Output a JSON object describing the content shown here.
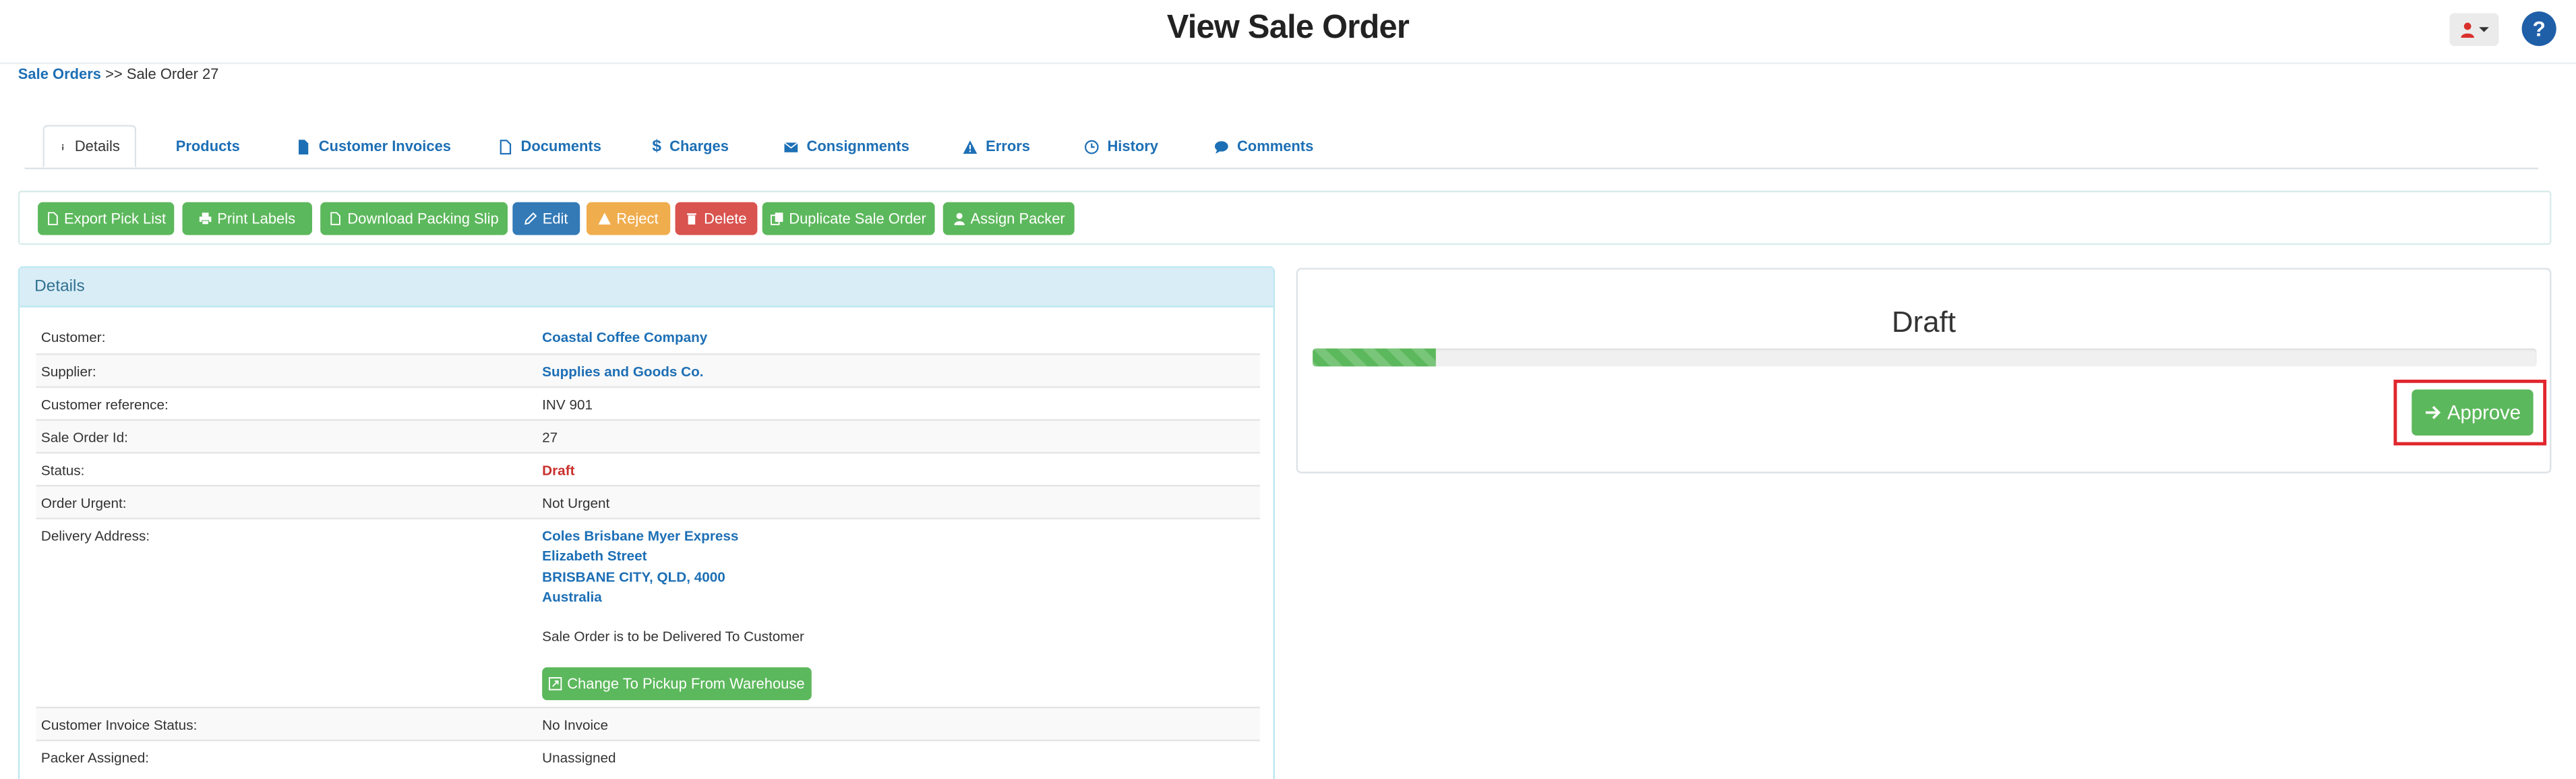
{
  "header": {
    "title": "View Sale Order",
    "help_label": "?"
  },
  "breadcrumb": {
    "link": "Sale Orders",
    "separator": ">>",
    "current": "Sale Order 27"
  },
  "tabs": [
    {
      "label": "Details",
      "icon": "info-icon"
    },
    {
      "label": "Products",
      "icon": ""
    },
    {
      "label": "Customer Invoices",
      "icon": "file-icon"
    },
    {
      "label": "Documents",
      "icon": "file-outline-icon"
    },
    {
      "label": "Charges",
      "icon": "dollar-icon"
    },
    {
      "label": "Consignments",
      "icon": "envelope-icon"
    },
    {
      "label": "Errors",
      "icon": "warning-icon"
    },
    {
      "label": "History",
      "icon": "clock-icon"
    },
    {
      "label": "Comments",
      "icon": "comment-icon"
    }
  ],
  "toolbar": {
    "export_pick_list": "Export Pick List",
    "print_labels": "Print Labels",
    "download_packing_slip": "Download Packing Slip",
    "edit": "Edit",
    "reject": "Reject",
    "delete": "Delete",
    "duplicate_sale_order": "Duplicate Sale Order",
    "assign_packer": "Assign Packer"
  },
  "details": {
    "heading": "Details",
    "rows": [
      {
        "label": "Customer:",
        "value": "Coastal Coffee Company"
      },
      {
        "label": "Supplier:",
        "value": "Supplies and Goods Co."
      },
      {
        "label": "Customer reference:",
        "value": "INV 901"
      },
      {
        "label": "Sale Order Id:",
        "value": "27"
      },
      {
        "label": "Status:",
        "value": "Draft"
      },
      {
        "label": "Order Urgent:",
        "value": "Not Urgent"
      },
      {
        "label": "Delivery Address:",
        "value": ""
      },
      {
        "label": "Customer Invoice Status:",
        "value": "No Invoice"
      },
      {
        "label": "Packer Assigned:",
        "value": "Unassigned"
      }
    ],
    "address": {
      "line1": "Coles Brisbane Myer Express",
      "line2": "Elizabeth Street",
      "line3": "BRISBANE CITY, QLD, 4000",
      "line4": "Australia",
      "delivery_note": "Sale Order is to be Delivered To Customer",
      "change_button": "Change To Pickup From Warehouse"
    }
  },
  "status": {
    "title": "Draft",
    "progress_percent": 10,
    "approve_label": "Approve"
  },
  "colors": {
    "success": "#5cb85c",
    "primary": "#337ab7",
    "warning": "#f0ad4e",
    "danger": "#d9534f",
    "link": "#1d6fb5",
    "highlight": "#e0262d"
  }
}
